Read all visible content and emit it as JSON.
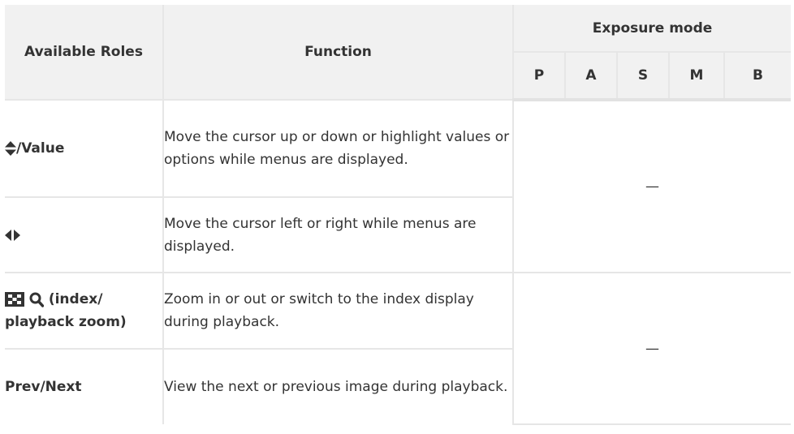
{
  "header": {
    "roles": "Available Roles",
    "function": "Function",
    "exposure_mode": "Exposure mode",
    "modes": [
      "P",
      "A",
      "S",
      "M",
      "B"
    ]
  },
  "rows": [
    {
      "icon": "up-down-arrows-icon",
      "role": "/Value",
      "function": "Move the cursor up or down or highlight values or options while menus are displayed."
    },
    {
      "icon": "left-right-arrows-icon",
      "role": "",
      "function": "Move the cursor left or right while menus are displayed."
    },
    {
      "icon": "index-playback-zoom-icons",
      "role_line1": " (index/",
      "role_line2": "playback zoom)",
      "function": "Zoom in or out or switch to the index display during playback."
    },
    {
      "role": "Prev/Next",
      "function": "View the next or previous image during playback."
    }
  ],
  "dash_groups": [
    "—",
    "—"
  ]
}
